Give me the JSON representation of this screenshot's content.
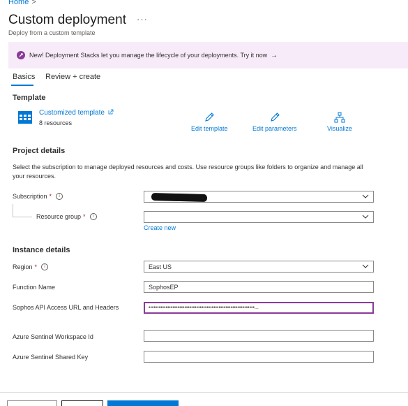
{
  "breadcrumb": {
    "home": "Home",
    "separator": ">"
  },
  "header": {
    "title": "Custom deployment",
    "subtitle": "Deploy from a custom template",
    "more": "···"
  },
  "banner": {
    "text": "New! Deployment Stacks let you manage the lifecycle of your deployments. Try it now",
    "arrow": "→"
  },
  "tabs": [
    {
      "label": "Basics",
      "active": true
    },
    {
      "label": "Review + create",
      "active": false
    }
  ],
  "template": {
    "heading": "Template",
    "link": "Customized template",
    "resources": "8 resources",
    "actions": [
      {
        "label": "Edit template",
        "icon": "pencil-icon"
      },
      {
        "label": "Edit parameters",
        "icon": "pencil-icon"
      },
      {
        "label": "Visualize",
        "icon": "hierarchy-icon"
      }
    ]
  },
  "project": {
    "heading": "Project details",
    "description": "Select the subscription to manage deployed resources and costs. Use resource groups like folders to organize and manage all your resources.",
    "subscription_label": "Subscription",
    "subscription_value": "",
    "resource_group_label": "Resource group",
    "resource_group_value": "",
    "create_new": "Create new"
  },
  "instance": {
    "heading": "Instance details",
    "region_label": "Region",
    "region_value": "East US",
    "function_name_label": "Function Name",
    "function_name_value": "SophosEP",
    "sophos_label": "Sophos API Access URL and Headers",
    "sophos_value": "••••••••••••••••••••••••••••••••••••••••••••••••••••••••••••••...",
    "workspace_label": "Azure Sentinel Workspace Id",
    "workspace_value": "",
    "shared_key_label": "Azure Sentinel Shared Key",
    "shared_key_value": ""
  },
  "colors": {
    "accent": "#0078d4",
    "banner_bg": "#f8ebf9",
    "banner_icon": "#8a3b98",
    "required": "#a4262c"
  }
}
